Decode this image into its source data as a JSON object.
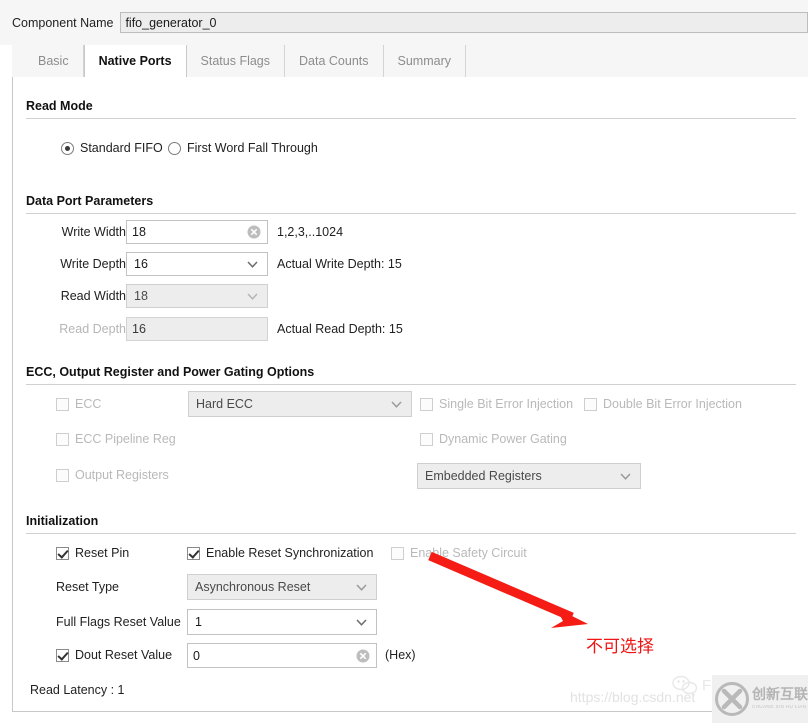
{
  "header": {
    "component_name_label": "Component Name",
    "component_name_value": "fifo_generator_0"
  },
  "tabs": [
    {
      "label": "Basic",
      "active": false
    },
    {
      "label": "Native Ports",
      "active": true
    },
    {
      "label": "Status Flags",
      "active": false
    },
    {
      "label": "Data Counts",
      "active": false
    },
    {
      "label": "Summary",
      "active": false
    }
  ],
  "read_mode": {
    "title": "Read Mode",
    "options": [
      {
        "label": "Standard FIFO",
        "selected": true
      },
      {
        "label": "First Word Fall Through",
        "selected": false
      }
    ]
  },
  "data_port": {
    "title": "Data Port Parameters",
    "write_width": {
      "label": "Write Width",
      "value": "18",
      "hint": "1,2,3,..1024",
      "clear_icon": "clear-circle-icon"
    },
    "write_depth": {
      "label": "Write Depth",
      "value": "16",
      "note": "Actual Write Depth: 15"
    },
    "read_width": {
      "label": "Read Width",
      "value": "18",
      "note": ""
    },
    "read_depth": {
      "label": "Read Depth",
      "value": "16",
      "note": "Actual Read Depth: 15"
    }
  },
  "ecc": {
    "title": "ECC, Output Register and Power Gating Options",
    "ecc_checkbox": {
      "label": "ECC",
      "checked": false,
      "enabled": false
    },
    "ecc_mode": {
      "value": "Hard ECC",
      "enabled": false
    },
    "single_bit": {
      "label": "Single Bit Error Injection",
      "checked": false,
      "enabled": false
    },
    "double_bit": {
      "label": "Double Bit Error Injection",
      "checked": false,
      "enabled": false
    },
    "ecc_pipeline": {
      "label": "ECC Pipeline Reg",
      "checked": false,
      "enabled": false
    },
    "dynamic_power": {
      "label": "Dynamic Power Gating",
      "checked": false,
      "enabled": false
    },
    "output_registers": {
      "label": "Output Registers",
      "checked": false,
      "enabled": false
    },
    "register_type": {
      "value": "Embedded Registers",
      "enabled": false
    }
  },
  "initialization": {
    "title": "Initialization",
    "reset_pin": {
      "label": "Reset Pin",
      "checked": true,
      "enabled": true
    },
    "enable_reset_sync": {
      "label": "Enable Reset Synchronization",
      "checked": true,
      "enabled": true
    },
    "enable_safety_circuit": {
      "label": "Enable Safety Circuit",
      "checked": false,
      "enabled": false
    },
    "reset_type": {
      "label": "Reset Type",
      "value": "Asynchronous Reset",
      "enabled": false
    },
    "full_flags_reset_value": {
      "label": "Full Flags Reset Value",
      "value": "1",
      "enabled": true
    },
    "dout_reset_value": {
      "label": "Dout Reset Value",
      "checked": true,
      "value": "0",
      "suffix": "(Hex)",
      "clear_icon": "clear-circle-icon"
    },
    "read_latency": "Read Latency : 1"
  },
  "annotation": {
    "text": "不可选择",
    "color": "#f01414",
    "arrow_icon": "red-arrow-icon"
  },
  "watermark": {
    "url": "https://blog.csdn.net",
    "wechat_label": "FP",
    "logo_cn": "创新互联",
    "logo_pinyin": "CHUANG XIN HU LIAN",
    "logo_icon": "x-badge-icon"
  }
}
